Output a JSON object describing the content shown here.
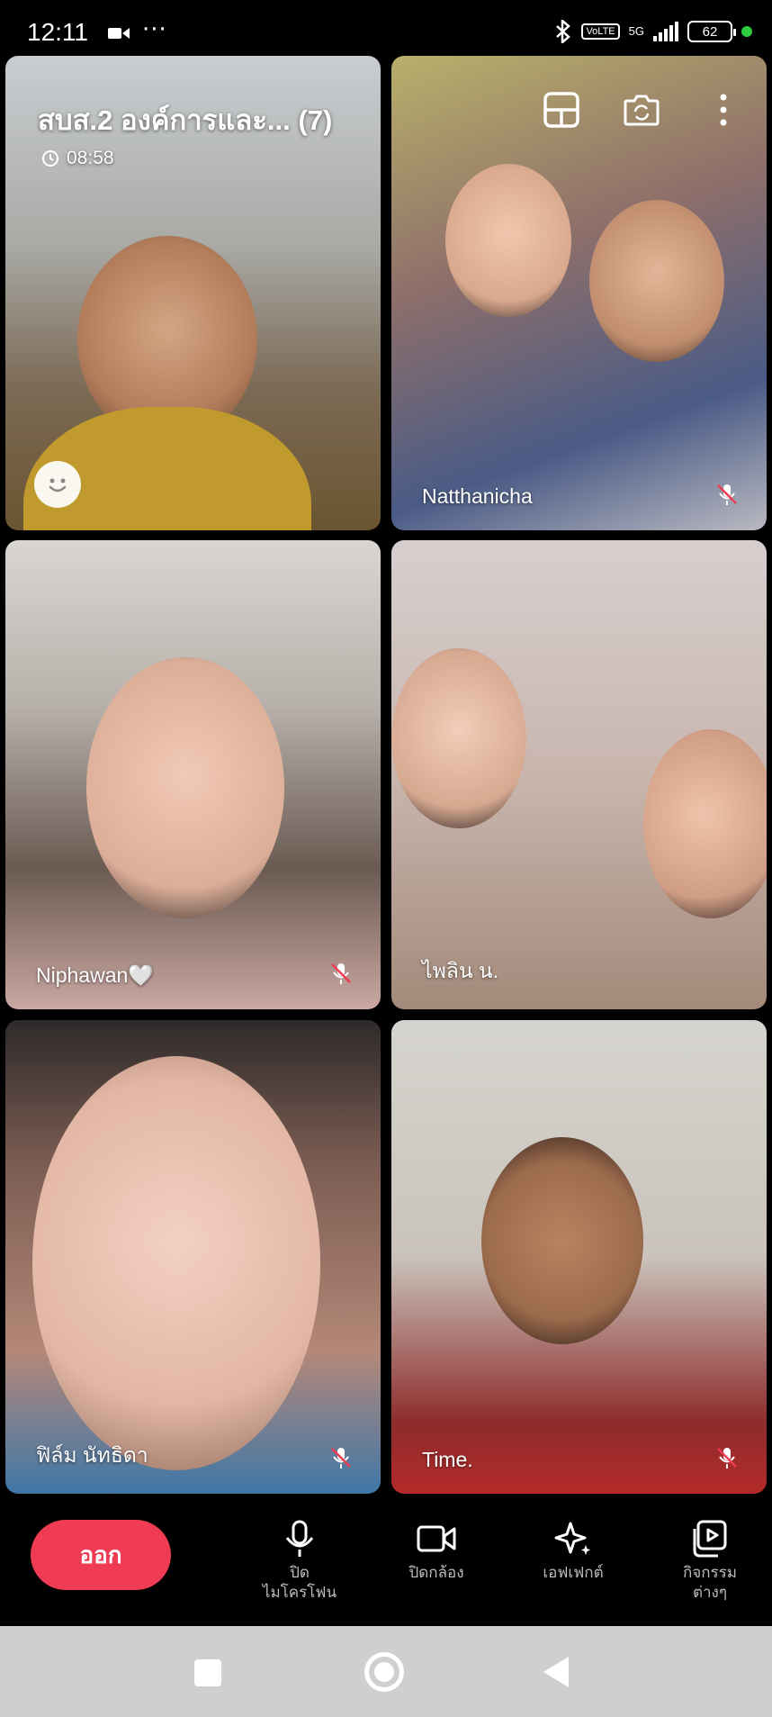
{
  "status_bar": {
    "time": "12:11",
    "more": "···",
    "volte": "VoLTE",
    "network": "5G",
    "battery": "62",
    "icons": [
      "video-indicator-icon",
      "bluetooth-icon",
      "signal-icon",
      "battery-icon"
    ]
  },
  "call": {
    "title": "สบส.2 องค์การและ... (7)",
    "timer": "08:58"
  },
  "participants": [
    {
      "name": "",
      "muted": false,
      "reaction_button": "emoji-icon"
    },
    {
      "name": "Natthanicha",
      "muted": true
    },
    {
      "name": "Niphawan🤍",
      "muted": true
    },
    {
      "name": "ไพลิน น.",
      "muted": false
    },
    {
      "name": "ฟิล์ม นัทธิดา",
      "muted": true
    },
    {
      "name": "Time.",
      "muted": true
    }
  ],
  "toolbar": {
    "leave_label": "ออก",
    "mic_label": "ปิด\nไมโครโฟน",
    "camera_label": "ปิดกล้อง",
    "effects_label": "เอฟเฟกต์",
    "activities_label": "กิจกรรม\nต่างๆ"
  },
  "colors": {
    "leave": "#ef3b53",
    "online_dot": "#2ecc40",
    "nav_bar": "#cfcfcf"
  }
}
